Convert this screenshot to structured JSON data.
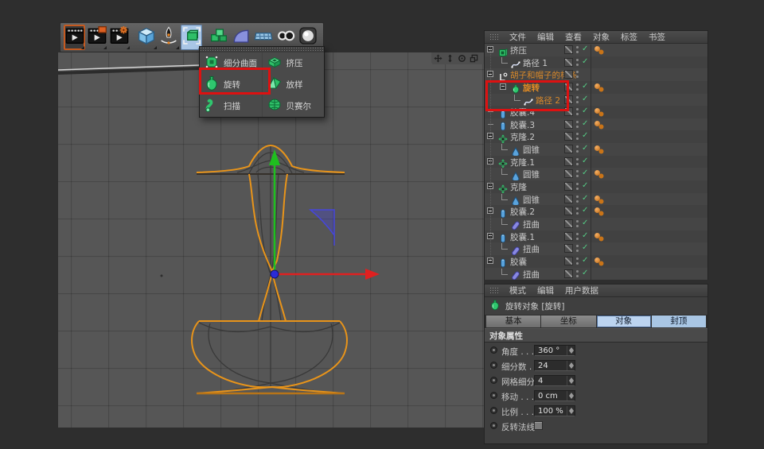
{
  "colors": {
    "selection_orange": "#e8941a",
    "axis_y_green": "#1fbf1f",
    "axis_x_red": "#e02020",
    "axis_handle_blue": "#4646dc",
    "annotation_red": "#dd1111",
    "active_tab_blue": "#bcd4f0",
    "material_tag_orange": "#c97418",
    "enabled_check_green": "#55cc85"
  },
  "toolbar": {
    "buttons": [
      {
        "icon": "render-view-icon",
        "selected": true
      },
      {
        "icon": "render-picture-viewer-icon"
      },
      {
        "icon": "render-settings-icon"
      },
      {
        "icon": "primitive-cube-icon",
        "gap_before": true
      },
      {
        "icon": "spline-pen-icon"
      },
      {
        "icon": "generators-icon",
        "active": true
      },
      {
        "icon": "modeling-icon",
        "gap_before": true
      },
      {
        "icon": "deformer-icon"
      },
      {
        "icon": "floor-icon"
      },
      {
        "icon": "metaball-icon"
      },
      {
        "icon": "light-icon"
      }
    ]
  },
  "generator_menu": {
    "columns": [
      [
        {
          "label": "细分曲面",
          "icon": "subdivision-surface-icon"
        },
        {
          "label": "旋转",
          "icon": "lathe-icon",
          "annotated": true
        },
        {
          "label": "扫描",
          "icon": "sweep-icon"
        }
      ],
      [
        {
          "label": "挤压",
          "icon": "extrude-icon"
        },
        {
          "label": "放样",
          "icon": "loft-icon"
        },
        {
          "label": "贝赛尔",
          "icon": "bezier-icon"
        }
      ]
    ]
  },
  "viewport": {
    "nav_icons": [
      "pan-icon",
      "dolly-icon",
      "rotate-icon",
      "toggle-view-icon"
    ]
  },
  "object_manager": {
    "menu": [
      "文件",
      "编辑",
      "查看",
      "对象",
      "标签",
      "书签"
    ],
    "items": [
      {
        "label": "挤压",
        "icon": "extrude-object-icon",
        "depth": 0,
        "expand": "box",
        "check": true,
        "tags": true
      },
      {
        "label": "路径 1",
        "icon": "spline-icon",
        "depth": 1,
        "connector": true,
        "check": true
      },
      {
        "label": "胡子和帽子的样条",
        "icon": "null-icon",
        "depth": 0,
        "expand": "box",
        "style": "orange"
      },
      {
        "label": "旋转",
        "icon": "lathe-icon",
        "depth": 1,
        "expand": "box",
        "check": true,
        "tags": true,
        "style": "orange-bold"
      },
      {
        "label": "路径 2",
        "icon": "spline-icon",
        "depth": 2,
        "connector": true,
        "check": true,
        "style": "orange"
      },
      {
        "label": "胶囊.4",
        "icon": "capsule-icon",
        "depth": 0,
        "expand": "dash",
        "check": true,
        "tags": true
      },
      {
        "label": "胶囊.3",
        "icon": "capsule-icon",
        "depth": 0,
        "expand": "dash",
        "check": true,
        "tags": true
      },
      {
        "label": "克隆.2",
        "icon": "cloner-icon",
        "depth": 0,
        "expand": "box",
        "check": true
      },
      {
        "label": "圆锥",
        "icon": "cone-icon",
        "depth": 1,
        "connector": true,
        "check": true,
        "tags": true
      },
      {
        "label": "克隆.1",
        "icon": "cloner-icon",
        "depth": 0,
        "expand": "box",
        "check": true
      },
      {
        "label": "圆锥",
        "icon": "cone-icon",
        "depth": 1,
        "connector": true,
        "check": true,
        "tags": true
      },
      {
        "label": "克隆",
        "icon": "cloner-icon",
        "depth": 0,
        "expand": "box",
        "check": true
      },
      {
        "label": "圆锥",
        "icon": "cone-icon",
        "depth": 1,
        "connector": true,
        "check": true,
        "tags": true
      },
      {
        "label": "胶囊.2",
        "icon": "capsule-icon",
        "depth": 0,
        "expand": "box",
        "check": true,
        "tags": true
      },
      {
        "label": "扭曲",
        "icon": "bend-icon",
        "depth": 1,
        "connector": true,
        "check": true
      },
      {
        "label": "胶囊.1",
        "icon": "capsule-icon",
        "depth": 0,
        "expand": "box",
        "check": true,
        "tags": true
      },
      {
        "label": "扭曲",
        "icon": "bend-icon",
        "depth": 1,
        "connector": true,
        "check": true
      },
      {
        "label": "胶囊",
        "icon": "capsule-icon",
        "depth": 0,
        "expand": "box",
        "check": true,
        "tags": true
      },
      {
        "label": "扭曲",
        "icon": "bend-icon",
        "depth": 1,
        "connector": true,
        "check": true
      }
    ]
  },
  "attribute_manager": {
    "menu": [
      "模式",
      "编辑",
      "用户数据"
    ],
    "object_title": "旋转对象 [旋转]",
    "object_icon": "lathe-icon",
    "tabs": [
      {
        "label": "基本",
        "state": "normal"
      },
      {
        "label": "坐标",
        "state": "normal"
      },
      {
        "label": "对象",
        "state": "active"
      },
      {
        "label": "封顶",
        "state": "highlight"
      }
    ],
    "section_title": "对象属性",
    "properties": [
      {
        "label": "角度",
        "dots": ". . .",
        "value": "360 °",
        "control": "stepper"
      },
      {
        "label": "细分数",
        "dots": ". .",
        "value": "24",
        "control": "stepper"
      },
      {
        "label": "网格细分",
        "dots": "",
        "value": "4",
        "control": "stepper"
      },
      {
        "label": "移动",
        "dots": ". . .",
        "value": "0 cm",
        "control": "stepper"
      },
      {
        "label": "比例",
        "dots": ". . .",
        "value": "100 %",
        "control": "stepper"
      },
      {
        "label": "反转法线",
        "dots": "",
        "control": "checkbox",
        "checked": false
      }
    ]
  }
}
